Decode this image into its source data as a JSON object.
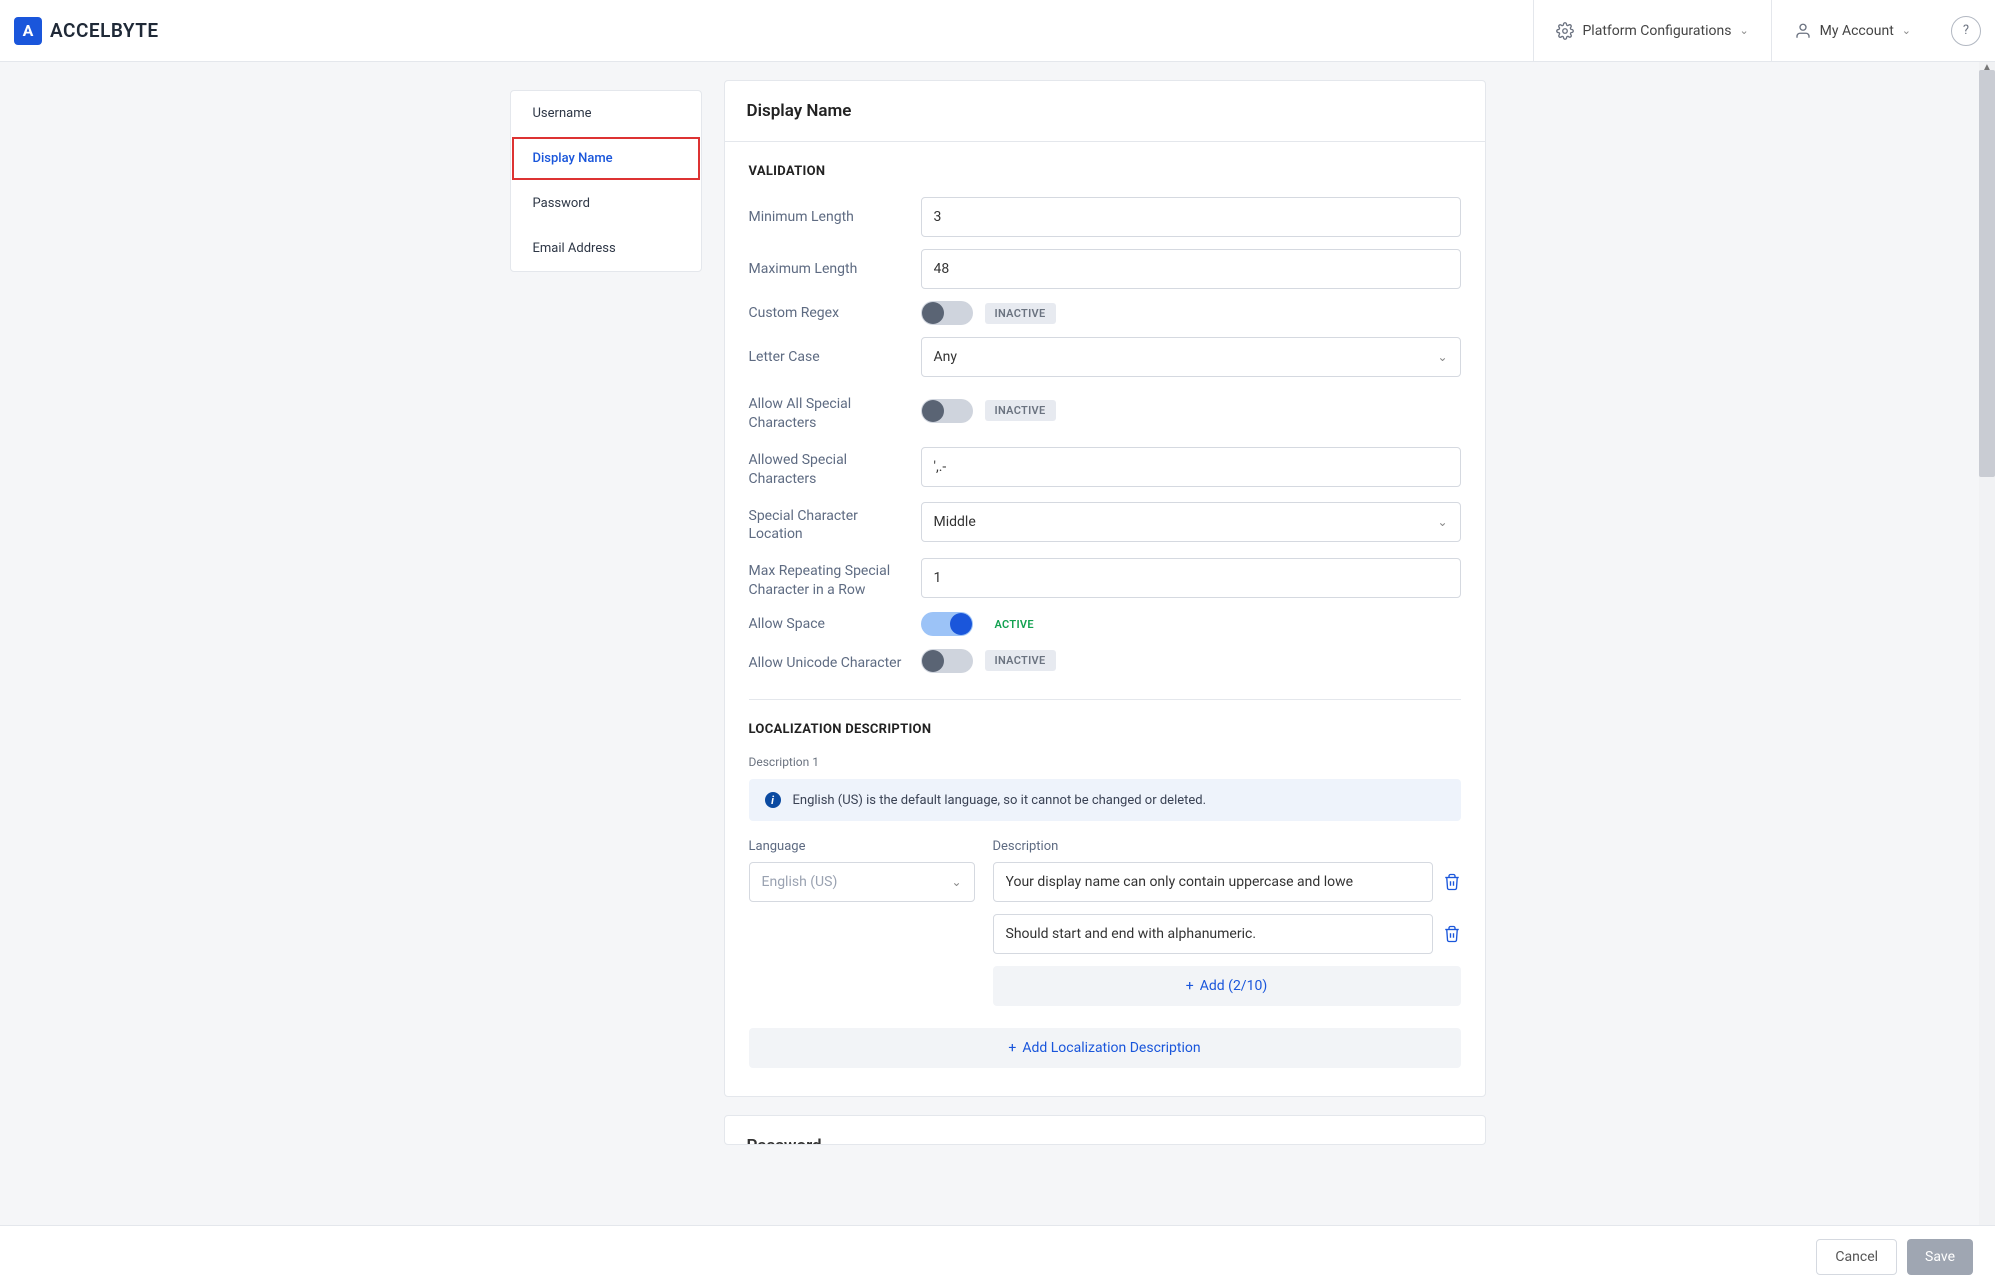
{
  "brand": {
    "text": "ACCELBYTE",
    "mark": "A"
  },
  "topbar": {
    "platform": "Platform Configurations",
    "account": "My Account"
  },
  "sidebar": {
    "items": [
      {
        "label": "Username"
      },
      {
        "label": "Display Name"
      },
      {
        "label": "Password"
      },
      {
        "label": "Email Address"
      }
    ]
  },
  "main": {
    "title": "Display Name",
    "validation_label": "VALIDATION",
    "fields": {
      "min_len": {
        "label": "Minimum Length",
        "value": "3"
      },
      "max_len": {
        "label": "Maximum Length",
        "value": "48"
      },
      "regex": {
        "label": "Custom Regex",
        "state": "INACTIVE"
      },
      "letter_case": {
        "label": "Letter Case",
        "value": "Any"
      },
      "allow_special": {
        "label": "Allow All Special Characters",
        "state": "INACTIVE"
      },
      "allowed_special": {
        "label": "Allowed Special Characters",
        "value": "',.-"
      },
      "special_loc": {
        "label": "Special Character Location",
        "value": "Middle"
      },
      "max_repeat": {
        "label": "Max Repeating Special Character in a Row",
        "value": "1"
      },
      "allow_space": {
        "label": "Allow Space",
        "state": "ACTIVE"
      },
      "allow_unicode": {
        "label": "Allow Unicode Character",
        "state": "INACTIVE"
      }
    },
    "loc": {
      "label": "LOCALIZATION DESCRIPTION",
      "sub": "Description 1",
      "info": "English (US) is the default language, so it cannot be changed or deleted.",
      "lang_label": "Language",
      "desc_label": "Description",
      "lang_value": "English (US)",
      "descs": [
        "Your display name can only contain uppercase and lowe",
        "Should start and end with alphanumeric."
      ],
      "add_label": "Add (2/10)",
      "add_loc": "Add Localization Description"
    },
    "next_title": "Password"
  },
  "footer": {
    "cancel": "Cancel",
    "save": "Save"
  }
}
